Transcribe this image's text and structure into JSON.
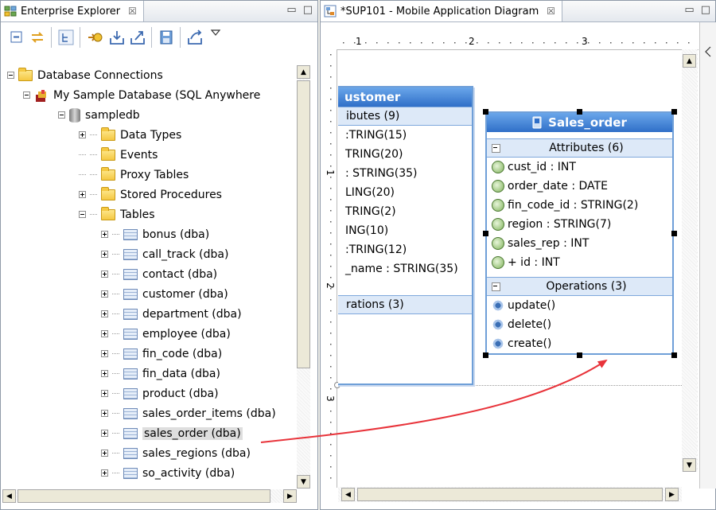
{
  "explorer": {
    "title": "Enterprise Explorer",
    "close_glyph": "☒",
    "tree": [
      {
        "label": "Database Connections",
        "level": 0,
        "expander": "minus",
        "icon": "folder-open-icon"
      },
      {
        "label": "My Sample Database (SQL Anywhere",
        "level": 1,
        "expander": "minus",
        "icon": "database-connection-icon"
      },
      {
        "label": "sampledb",
        "level": 2,
        "expander": "minus",
        "icon": "database-icon"
      },
      {
        "label": "Data Types",
        "level": 3,
        "expander": "plus",
        "icon": "folder-icon"
      },
      {
        "label": "Events",
        "level": 3,
        "expander": "none",
        "icon": "folder-icon"
      },
      {
        "label": "Proxy Tables",
        "level": 3,
        "expander": "none",
        "icon": "folder-icon"
      },
      {
        "label": "Stored Procedures",
        "level": 3,
        "expander": "plus",
        "icon": "folder-icon"
      },
      {
        "label": "Tables",
        "level": 3,
        "expander": "minus",
        "icon": "folder-icon"
      },
      {
        "label": "bonus (dba)",
        "level": 4,
        "expander": "plus",
        "icon": "table-icon"
      },
      {
        "label": "call_track (dba)",
        "level": 4,
        "expander": "plus",
        "icon": "table-icon"
      },
      {
        "label": "contact (dba)",
        "level": 4,
        "expander": "plus",
        "icon": "table-icon"
      },
      {
        "label": "customer (dba)",
        "level": 4,
        "expander": "plus",
        "icon": "table-icon"
      },
      {
        "label": "department (dba)",
        "level": 4,
        "expander": "plus",
        "icon": "table-icon"
      },
      {
        "label": "employee (dba)",
        "level": 4,
        "expander": "plus",
        "icon": "table-icon"
      },
      {
        "label": "fin_code (dba)",
        "level": 4,
        "expander": "plus",
        "icon": "table-icon"
      },
      {
        "label": "fin_data (dba)",
        "level": 4,
        "expander": "plus",
        "icon": "table-icon"
      },
      {
        "label": "product (dba)",
        "level": 4,
        "expander": "plus",
        "icon": "table-icon"
      },
      {
        "label": "sales_order_items (dba)",
        "level": 4,
        "expander": "plus",
        "icon": "table-icon"
      },
      {
        "label": "sales_order (dba)",
        "level": 4,
        "expander": "plus",
        "icon": "table-icon",
        "selected": true
      },
      {
        "label": "sales_regions (dba)",
        "level": 4,
        "expander": "plus",
        "icon": "table-icon"
      },
      {
        "label": "so_activity (dba)",
        "level": 4,
        "expander": "plus",
        "icon": "table-icon"
      }
    ]
  },
  "diagram": {
    "title": "*SUP101 - Mobile Application Diagram",
    "close_glyph": "☒",
    "ruler_top_marks": [
      "1",
      "2",
      "3"
    ],
    "ruler_left_marks": [
      "1",
      "2",
      "3"
    ],
    "customer_box": {
      "title": "ustomer",
      "attributes_header": "ibutes (9)",
      "attributes": [
        ":TRING(15)",
        "TRING(20)",
        ": STRING(35)",
        "LING(20)",
        "TRING(2)",
        "ING(10)",
        ":TRING(12)",
        "_name : STRING(35)"
      ],
      "operations_header": "rations (3)"
    },
    "sales_order_box": {
      "title": "Sales_order",
      "attributes_header": "Attributes (6)",
      "attributes": [
        "cust_id : INT",
        "order_date : DATE",
        "fin_code_id : STRING(2)",
        "region : STRING(7)",
        "sales_rep : INT",
        "+ id : INT"
      ],
      "operations_header": "Operations (3)",
      "operations": [
        "update()",
        "delete()",
        "create()"
      ]
    }
  },
  "colors": {
    "selection_arrow": "#e8333a",
    "uml_header": "#2f6fc8",
    "uml_section": "#dde9f8"
  }
}
